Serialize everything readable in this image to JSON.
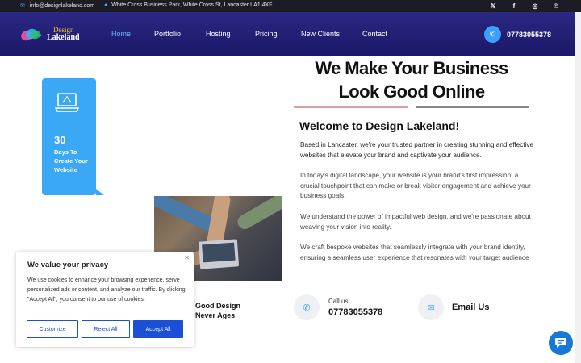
{
  "topbar": {
    "email": "info@designlakeland.com",
    "address": "White Cross Business Park, White Cross St, Lancaster LA1 4XF",
    "email_icon": "envelope-icon",
    "location_icon": "map-pin-icon",
    "social": [
      "twitter-icon",
      "facebook-icon",
      "instagram-icon",
      "pinterest-icon"
    ]
  },
  "logo": {
    "line1": "Design",
    "line2": "Lakeland"
  },
  "nav": {
    "items": [
      "Home",
      "Portfolio",
      "Hosting",
      "Pricing",
      "New Clients",
      "Contact"
    ],
    "active": "Home",
    "phone": "07783055378"
  },
  "badge": {
    "number": "30",
    "text": "Days To Create Your Website"
  },
  "tagline": "Good Design Never Ages",
  "hero": {
    "title": "We Make Your Business Look Good Online",
    "welcome": "Welcome to Design Lakeland!",
    "paragraphs": [
      "Based in Lancaster, we're your trusted partner in creating stunning and effective websites that elevate your brand and captivate your audience.",
      "In today's digital landscape, your website is your brand's first impression, a crucial touchpoint that can make or break visitor engagement and achieve your business goals.",
      "We understand the power of impactful web design, and we're passionate about weaving your vision into reality.",
      "We craft bespoke websites that seamlessly integrate with your brand identity, ensuring a seamless user experience that resonates with your target audience"
    ]
  },
  "contact": {
    "call_label": "Call us",
    "phone": "07783055378",
    "email_label": "Email Us"
  },
  "cookie": {
    "title": "We value your privacy",
    "body": "We use cookies to enhance your browsing experience, serve personalized ads or content, and analyze our traffic. By clicking \"Accept All\", you consent to our use of cookies.",
    "customize": "Customize",
    "reject": "Reject All",
    "accept": "Accept All"
  },
  "colors": {
    "nav_bg": "#211f78",
    "accent": "#3aa0ff",
    "button_blue": "#1a4fd6",
    "badge": "#3aa8f5"
  }
}
